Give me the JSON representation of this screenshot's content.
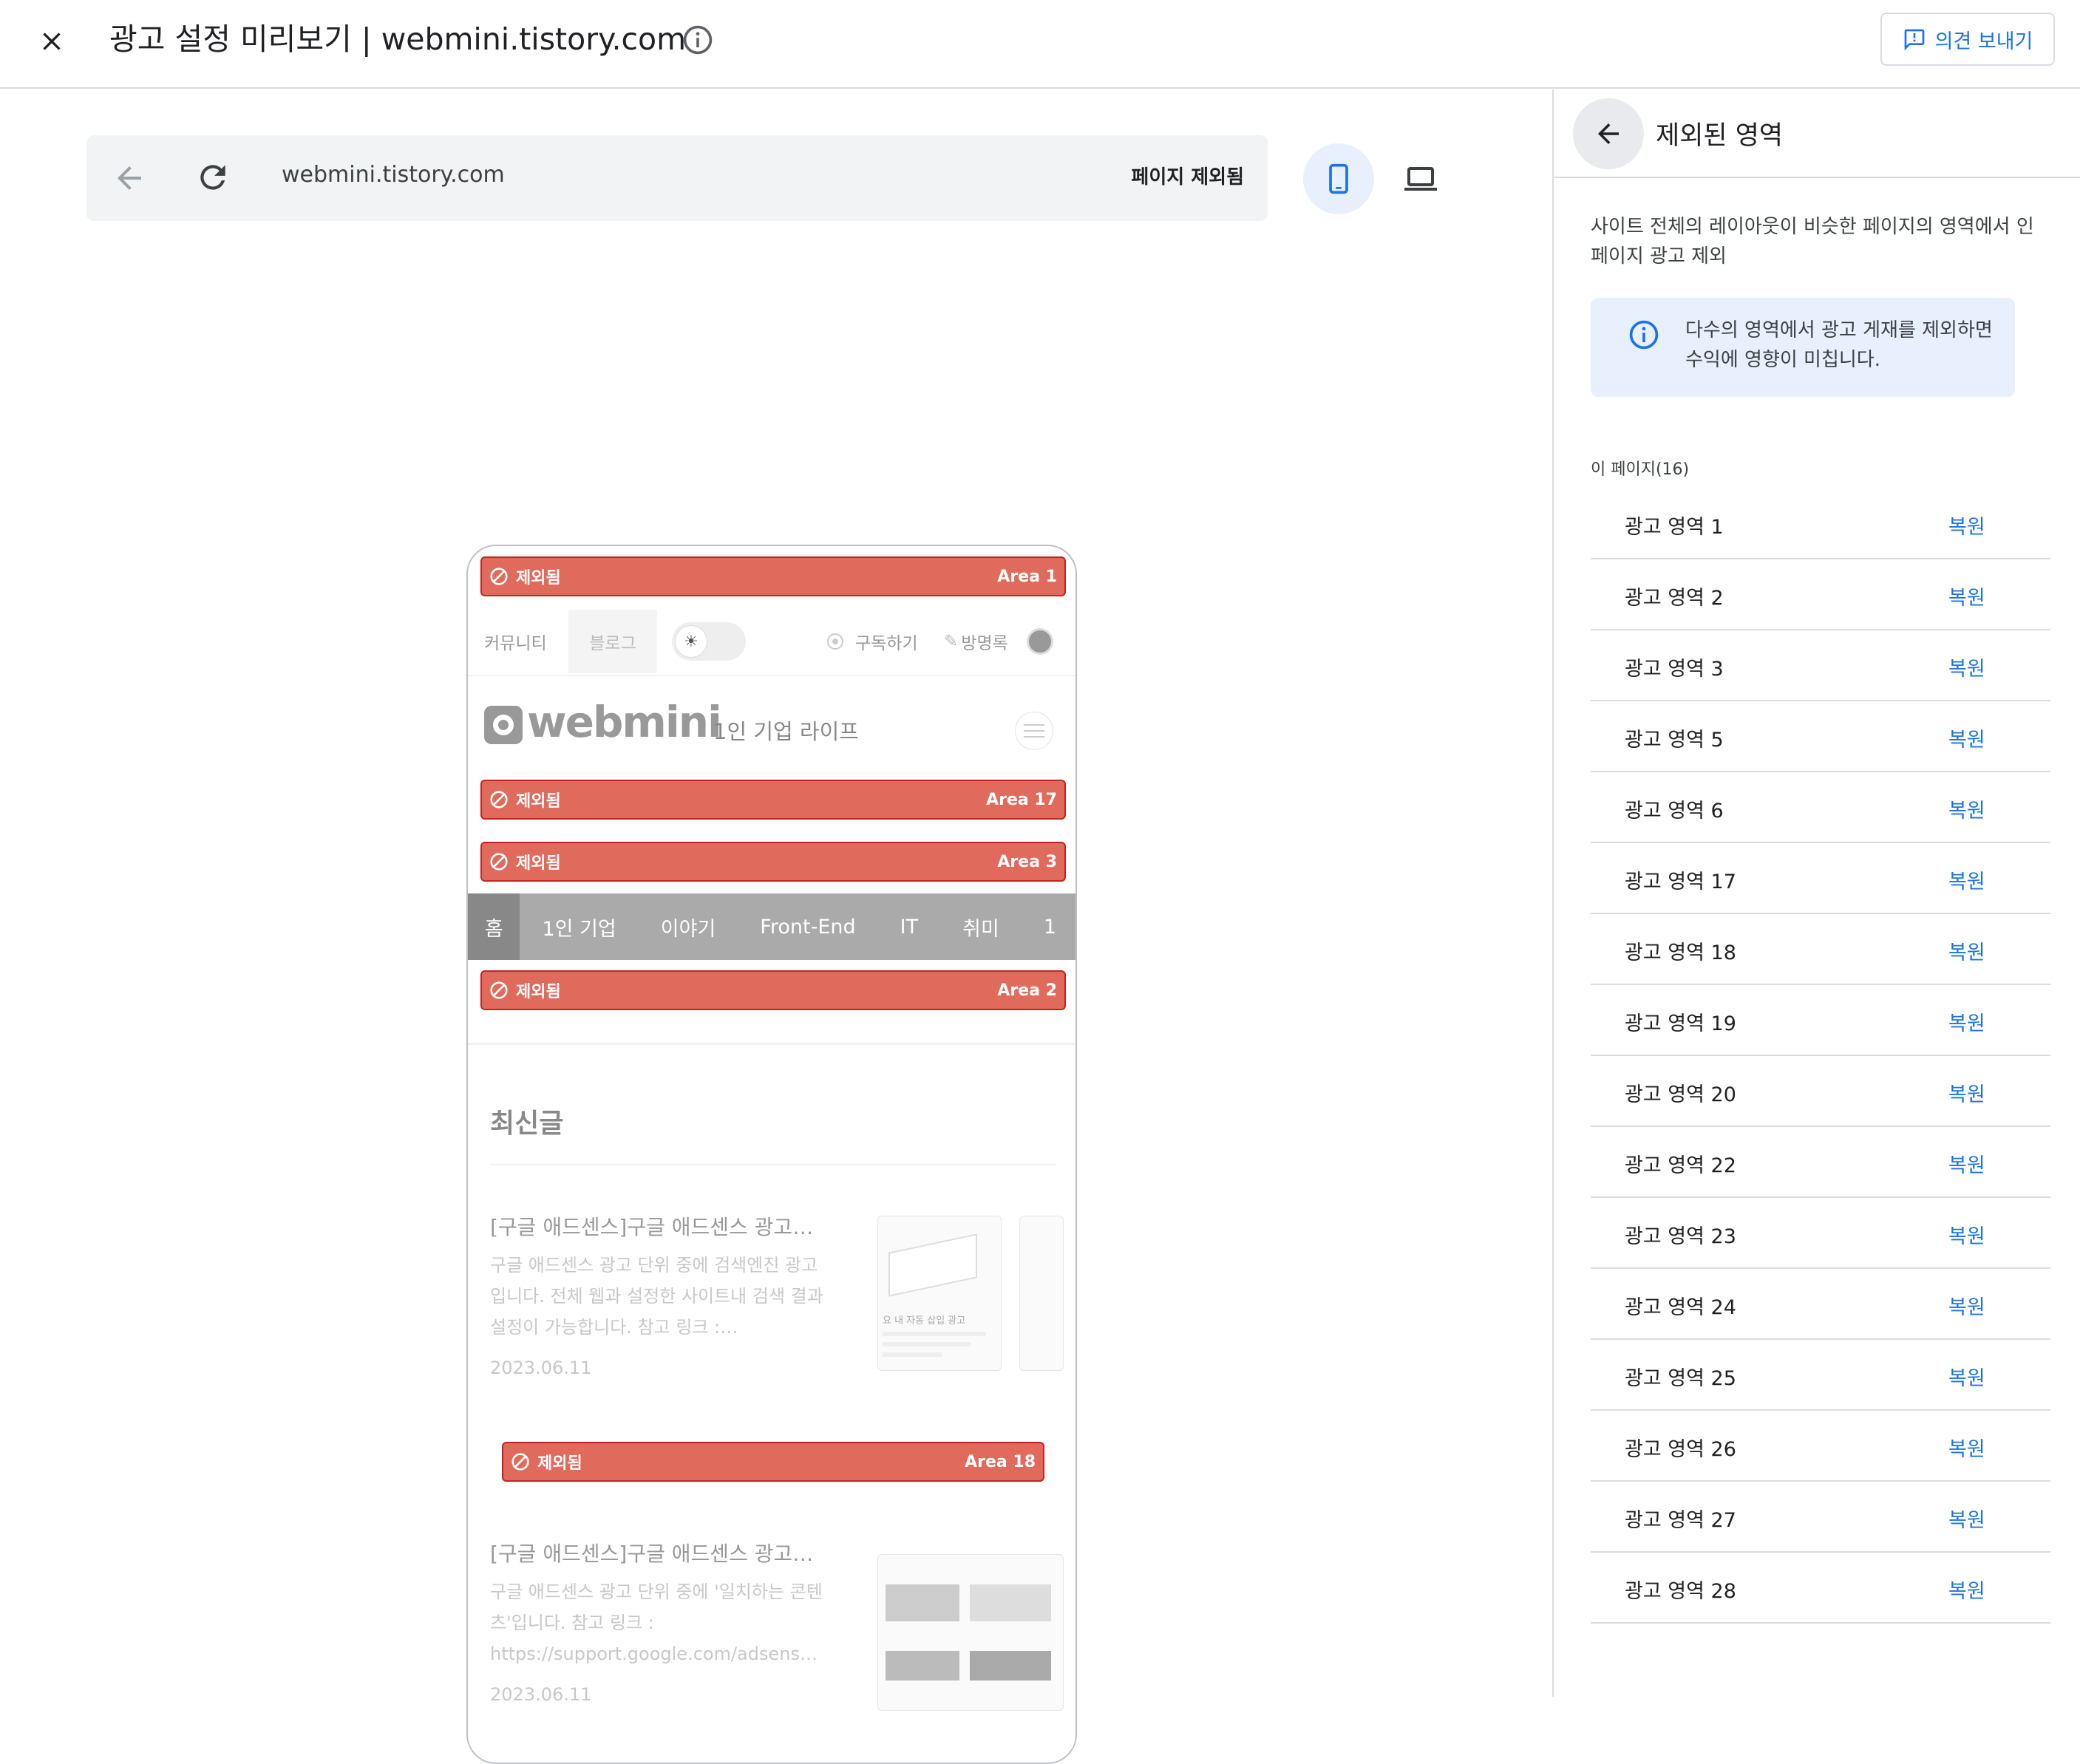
{
  "header": {
    "title": "광고 설정 미리보기 | webmini.tistory.com",
    "feedback_label": "의견 보내기"
  },
  "urlbar": {
    "url": "webmini.tistory.com",
    "page_excluded_label": "페이지 제외됨"
  },
  "preview": {
    "excluded_label": "제외됨",
    "bars": [
      "Area 1",
      "Area 17",
      "Area 3",
      "Area 2",
      "Area 18"
    ],
    "blog_nav": {
      "community": "커뮤니티",
      "blog": "블로그",
      "subscribe": "구독하기",
      "guestbook": "방명록"
    },
    "logo_text": "webmini",
    "tagline": "1인 기업 라이프",
    "menu": [
      "홈",
      "1인 기업",
      "이야기",
      "Front-End",
      "IT",
      "취미",
      "1"
    ],
    "section_title": "최신글",
    "posts": [
      {
        "title": "[구글 애드센스]구글 애드센스 광고…",
        "desc": "구글 애드센스 광고 단위 중에 검색엔진 광고입니다. 전체 웹과 설정한 사이트내 검색 결과 설정이 가능합니다. 참고 링크 :…",
        "date": "2023.06.11"
      },
      {
        "title": "[구글 애드센스]구글 애드센스 광고…",
        "desc": "구글 애드센스 광고 단위 중에 '일치하는 콘텐츠'입니다. 참고 링크 : https://support.google.com/adsens…",
        "date": "2023.06.11"
      }
    ],
    "thumb_caption": "요 내 자동 삽입 광고"
  },
  "side_panel": {
    "title": "제외된 영역",
    "description": "사이트 전체의 레이아웃이 비슷한 페이지의 영역에서 인페이지 광고 제외",
    "info": "다수의 영역에서 광고 게재를 제외하면 수익에 영향이 미칩니다.",
    "count_label": "이 페이지(16)",
    "restore_label": "복원",
    "areas": [
      "광고 영역 1",
      "광고 영역 2",
      "광고 영역 3",
      "광고 영역 5",
      "광고 영역 6",
      "광고 영역 17",
      "광고 영역 18",
      "광고 영역 19",
      "광고 영역 20",
      "광고 영역 22",
      "광고 영역 23",
      "광고 영역 24",
      "광고 영역 25",
      "광고 영역 26",
      "광고 영역 27",
      "광고 영역 28"
    ]
  },
  "colors": {
    "accent": "#1a73e8",
    "excluded_red": "#e06a5c"
  }
}
